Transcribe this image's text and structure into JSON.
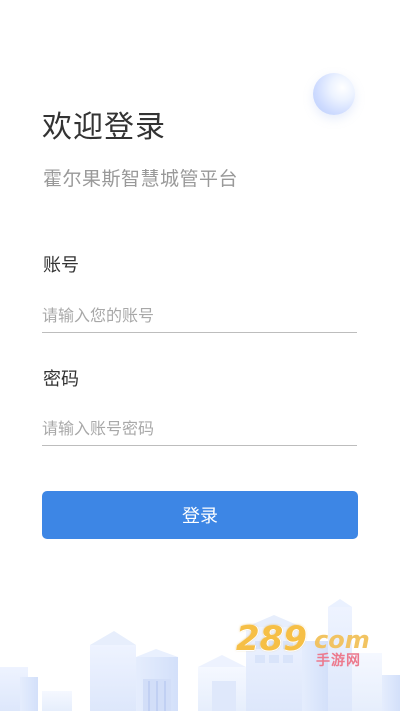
{
  "header": {
    "title": "欢迎登录",
    "subtitle": "霍尔果斯智慧城管平台"
  },
  "form": {
    "account": {
      "label": "账号",
      "placeholder": "请输入您的账号",
      "value": ""
    },
    "password": {
      "label": "密码",
      "placeholder": "请输入账号密码",
      "value": ""
    }
  },
  "actions": {
    "login_label": "登录"
  },
  "watermark": {
    "brand": "289",
    "domain": "com",
    "tag": "手游网"
  },
  "icons": {
    "decorative_orb": "decorative-orb-icon",
    "city_skyline": "city-skyline-illustration"
  },
  "colors": {
    "primary": "#3d86e5",
    "text": "#333333",
    "subtitle": "#999999",
    "placeholder": "#a8a8a8",
    "watermark_brand": "#f6bf46",
    "watermark_tag": "#ec7a8e"
  }
}
